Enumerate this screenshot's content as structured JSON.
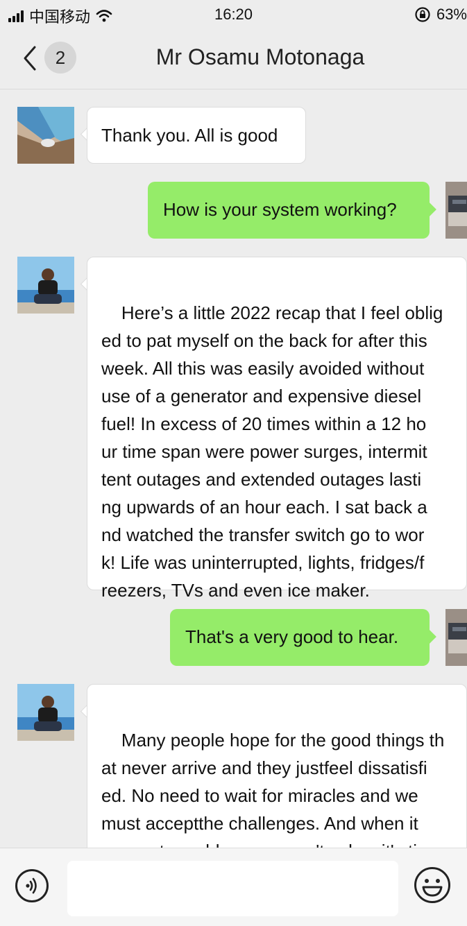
{
  "status_bar": {
    "carrier": "中国移动",
    "time": "16:20",
    "battery": "63%"
  },
  "header": {
    "unread_count": "2",
    "title": "Mr Osamu Motonaga"
  },
  "messages": [
    {
      "side": "in",
      "text": "Thank you. All is good"
    },
    {
      "side": "out",
      "text": "How is your system working?"
    },
    {
      "side": "in",
      "text": "Here’s a little 2022 recap that I feel oblig\ned to pat myself on the back for after this\nweek. All this was easily avoided without\nuse of a generator and expensive diesel\nfuel! In excess of 20 times within a 12 ho\nur time span were power surges, intermit\ntent outages and extended outages lasti\nng upwards of an hour each. I sat back a\nnd watched the transfer switch go to wor\nk! Life was uninterrupted, lights, fridges/f\nreezers, TVs and even ice maker."
    },
    {
      "side": "out",
      "text": "That's a very good to hear."
    },
    {
      "side": "in",
      "text": "Many people hope for the good things th\nat never arrive and they justfeel dissatisfi\ned. No need to wait for miracles and we\nmust acceptthe challenges. And when it\ncomes to problems we can't solve, it's ti"
    }
  ],
  "input": {
    "value": "",
    "placeholder": ""
  },
  "icons": {
    "back": "chevron-left-icon",
    "voice": "voice-icon",
    "emoji": "emoji-icon"
  }
}
